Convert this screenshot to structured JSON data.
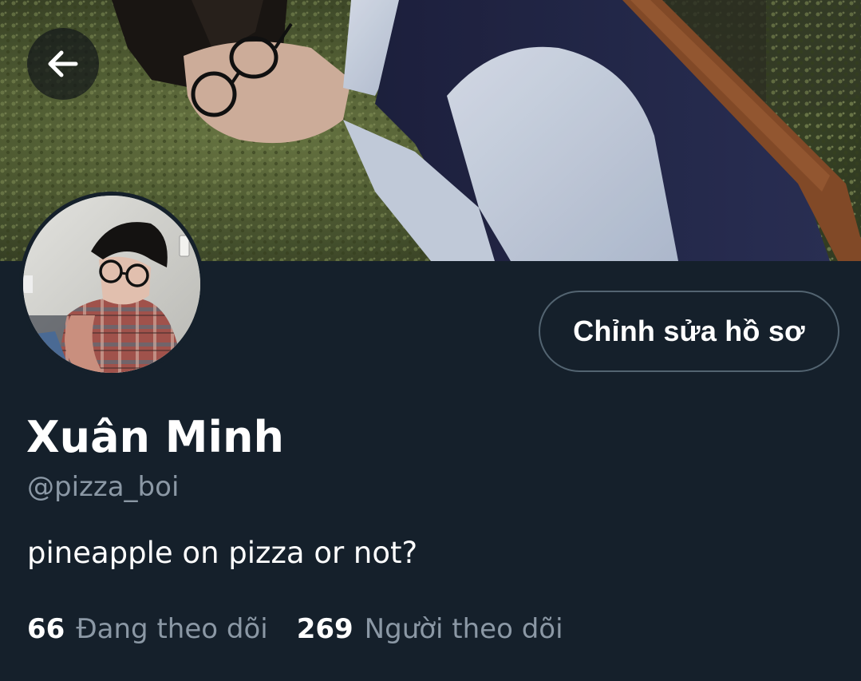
{
  "header": {
    "back_icon": "arrow-left-icon"
  },
  "profile": {
    "display_name": "Xuân Minh",
    "handle": "@pizza_boi",
    "bio": "pineapple on pizza or not?",
    "edit_label": "Chỉnh sửa hồ sơ",
    "stats": {
      "following_count": "66",
      "following_label": "Đang theo dõi",
      "followers_count": "269",
      "followers_label": "Người theo dõi"
    }
  },
  "colors": {
    "background": "#15202b",
    "primary_text": "#ffffff",
    "secondary_text": "#8b98a5",
    "button_border": "#536471"
  }
}
